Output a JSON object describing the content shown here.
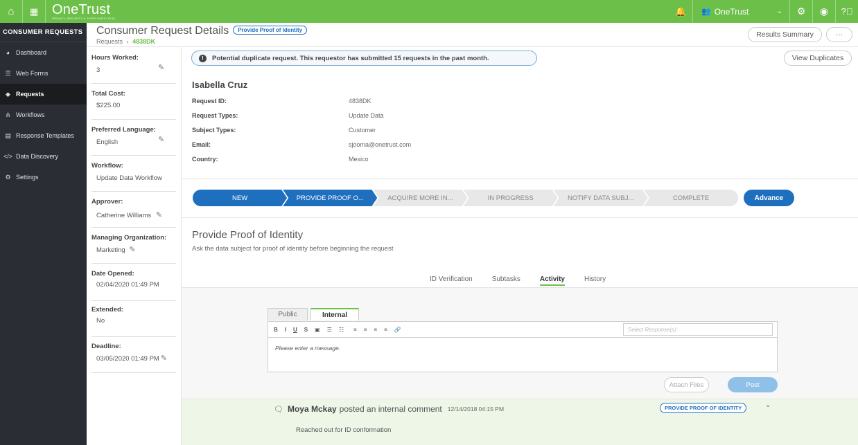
{
  "topbar": {
    "logo": "OneTrust",
    "logo_sub": "PRIVACY, SECURITY & THIRD-PARTY RISK",
    "org_name": "OneTrust",
    "icons": [
      "home-icon",
      "grid-icon",
      "bell-icon",
      "org-icon",
      "gear-icon",
      "user-icon",
      "help-icon"
    ]
  },
  "sidebar": {
    "title": "CONSUMER REQUESTS",
    "items": [
      {
        "label": "Dashboard",
        "icon": "dashboard-icon"
      },
      {
        "label": "Web Forms",
        "icon": "list-icon"
      },
      {
        "label": "Requests",
        "icon": "tag-icon",
        "active": true
      },
      {
        "label": "Workflows",
        "icon": "workflow-icon"
      },
      {
        "label": "Response Templates",
        "icon": "template-icon"
      },
      {
        "label": "Data Discovery",
        "icon": "code-icon"
      },
      {
        "label": "Settings",
        "icon": "gear-icon"
      }
    ]
  },
  "header": {
    "title": "Consumer Request Details",
    "stage_pill": "Provide Proof of Identity",
    "crumb_root": "Requests",
    "crumb_sep": "›",
    "crumb_id": "4838DK",
    "results_summary": "Results Summary",
    "more": "···"
  },
  "info": [
    {
      "label": "Hours Worked:",
      "value": "3"
    },
    {
      "label": "Total Cost:",
      "value": "$225.00"
    },
    {
      "label": "Preferred Language:",
      "value": "English"
    },
    {
      "label": "Workflow:",
      "value": "Update Data Workflow"
    },
    {
      "label": "Approver:",
      "value": "Catherine Williams"
    },
    {
      "label": "Managing Organization:",
      "value": "Marketing"
    },
    {
      "label": "Date Opened:",
      "value": "02/04/2020 01:49 PM"
    },
    {
      "label": "Extended:",
      "value": "No"
    },
    {
      "label": "Deadline:",
      "value": "03/05/2020 01:49 PM"
    }
  ],
  "alert": {
    "text": "Potential duplicate request. This requestor has submitted 15 requests in the past month.",
    "view_duplicates": "View Duplicates"
  },
  "request": {
    "name": "Isabella Cruz",
    "fields": [
      {
        "k": "Request ID:",
        "v": "4838DK"
      },
      {
        "k": "Request Types:",
        "v": "Update Data"
      },
      {
        "k": "Subject Types:",
        "v": "Customer"
      },
      {
        "k": "Email:",
        "v": "sjooma@onetrust.com"
      },
      {
        "k": "Country:",
        "v": "Mexico"
      }
    ]
  },
  "stages": [
    "NEW",
    "PROVIDE PROOF O...",
    "ACQUIRE MORE IN...",
    "IN PROGRESS",
    "NOTIFY DATA SUBJ...",
    "COMPLETE"
  ],
  "advance": "Advance",
  "section": {
    "title": "Provide Proof of Identity",
    "subtitle": "Ask the data subject for proof of identity before beginning the request"
  },
  "tabs": [
    "ID Verification",
    "Subtasks",
    "Activity",
    "History"
  ],
  "editor": {
    "tab_public": "Public",
    "tab_internal": "Internal",
    "toolbar": [
      "B",
      "I",
      "U",
      "S",
      "▣",
      "☰",
      "☷",
      "≡",
      "≡",
      "≡",
      "≡",
      "🔗"
    ],
    "select_placeholder": "Select Response(s)",
    "message_placeholder": "Please enter a message.",
    "attach": "Attach Files",
    "post": "Post"
  },
  "comment": {
    "author": "Moya Mckay",
    "action": "posted an internal comment",
    "timestamp": "12/14/2018 04:15 PM",
    "stage": "PROVIDE PROOF OF IDENTITY",
    "body": "Reached out for ID conformation"
  }
}
